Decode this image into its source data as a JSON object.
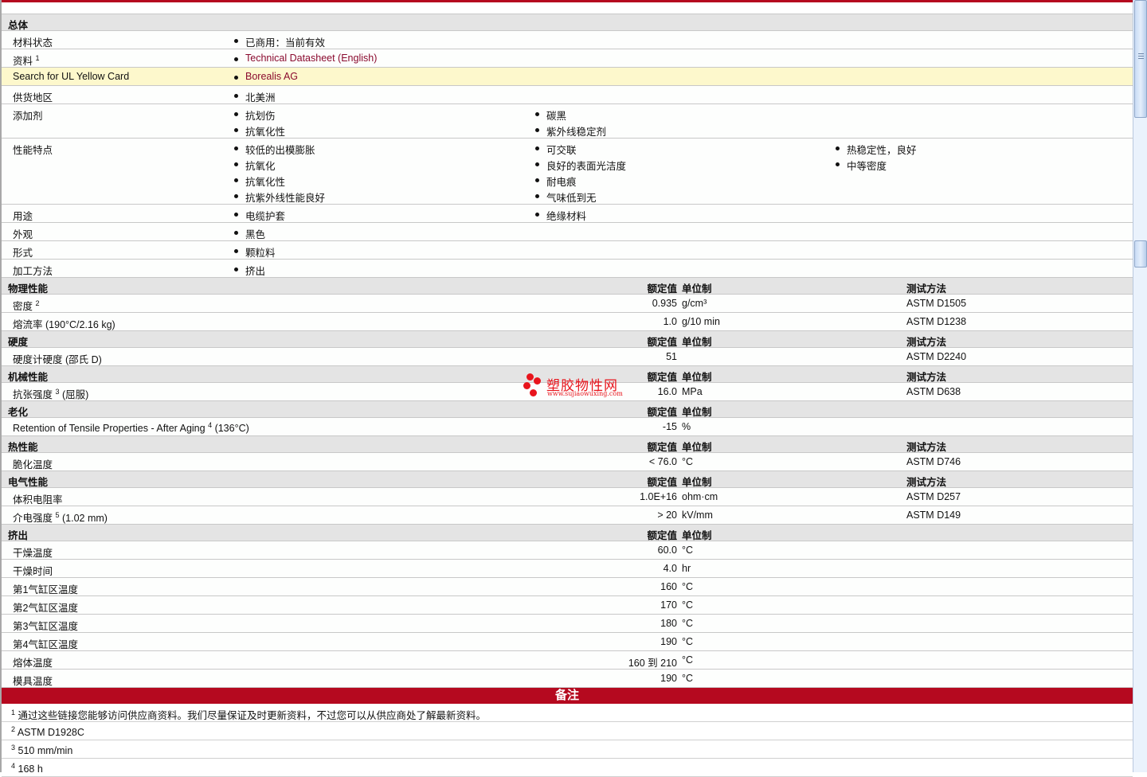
{
  "general": {
    "title": "总体",
    "rows": [
      {
        "label": "材料状态",
        "cols": [
          [
            "已商用：当前有效"
          ]
        ]
      },
      {
        "label": "资料",
        "sup": "1",
        "link": true,
        "cols": [
          [
            "Technical Datasheet (English)"
          ]
        ]
      },
      {
        "label": "Search for UL Yellow Card",
        "highlight": true,
        "link": true,
        "cols": [
          [
            "Borealis AG"
          ]
        ]
      },
      {
        "label": "供货地区",
        "cols": [
          [
            "北美洲"
          ]
        ]
      },
      {
        "label": "添加剂",
        "cols": [
          [
            "抗划伤",
            "抗氧化性"
          ],
          [
            "碳黑",
            "紫外线稳定剂"
          ]
        ]
      },
      {
        "label": "性能特点",
        "cols": [
          [
            "较低的出模膨胀",
            "抗氧化",
            "抗氧化性",
            "抗紫外线性能良好"
          ],
          [
            "可交联",
            "良好的表面光洁度",
            "耐电痕",
            "气味低到无"
          ],
          [
            "热稳定性，良好",
            "中等密度"
          ]
        ]
      },
      {
        "label": "用途",
        "cols": [
          [
            "电缆护套"
          ],
          [
            "绝缘材料"
          ]
        ]
      },
      {
        "label": "外观",
        "cols": [
          [
            "黑色"
          ]
        ]
      },
      {
        "label": "形式",
        "cols": [
          [
            "颗粒料"
          ]
        ]
      },
      {
        "label": "加工方法",
        "cols": [
          [
            "挤出"
          ]
        ]
      }
    ]
  },
  "sections": [
    {
      "title": "物理性能",
      "h_value": "额定值",
      "h_unit": "单位制",
      "h_method": "测试方法",
      "rows": [
        {
          "label": "密度",
          "sup": "2",
          "value": "0.935",
          "unit": "g/cm³",
          "method": "ASTM D1505"
        },
        {
          "label": "熔流率",
          "suffix": "(190°C/2.16 kg)",
          "value": "1.0",
          "unit": "g/10 min",
          "method": "ASTM D1238"
        }
      ]
    },
    {
      "title": "硬度",
      "h_value": "额定值",
      "h_unit": "单位制",
      "h_method": "测试方法",
      "rows": [
        {
          "label": "硬度计硬度",
          "suffix": "(邵氏 D)",
          "value": "51",
          "unit": "",
          "method": "ASTM D2240"
        }
      ]
    },
    {
      "title": "机械性能",
      "h_value": "额定值",
      "h_unit": "单位制",
      "h_method": "测试方法",
      "rows": [
        {
          "label": "抗张强度",
          "sup": "3",
          "suffix": "(屈服)",
          "value": "16.0",
          "unit": "MPa",
          "method": "ASTM D638"
        }
      ]
    },
    {
      "title": "老化",
      "h_value": "额定值",
      "h_unit": "单位制",
      "h_method": "",
      "rows": [
        {
          "label": "Retention of Tensile Properties - After Aging",
          "sup": "4",
          "suffix": "(136°C)",
          "value": "-15",
          "unit": "%",
          "method": ""
        }
      ]
    },
    {
      "title": "热性能",
      "h_value": "额定值",
      "h_unit": "单位制",
      "h_method": "测试方法",
      "rows": [
        {
          "label": "脆化温度",
          "value": "< 76.0",
          "unit": "°C",
          "method": "ASTM D746"
        }
      ]
    },
    {
      "title": "电气性能",
      "h_value": "额定值",
      "h_unit": "单位制",
      "h_method": "测试方法",
      "rows": [
        {
          "label": "体积电阻率",
          "value": "1.0E+16",
          "unit": "ohm·cm",
          "method": "ASTM D257"
        },
        {
          "label": "介电强度",
          "sup": "5",
          "suffix": "(1.02 mm)",
          "value": "> 20",
          "unit": "kV/mm",
          "method": "ASTM D149"
        }
      ]
    },
    {
      "title": "挤出",
      "h_value": "额定值",
      "h_unit": "单位制",
      "h_method": "",
      "rows": [
        {
          "label": "干燥温度",
          "value": "60.0",
          "unit": "°C",
          "method": ""
        },
        {
          "label": "干燥时间",
          "value": "4.0",
          "unit": "hr",
          "method": ""
        },
        {
          "label": "第1气缸区温度",
          "value": "160",
          "unit": "°C",
          "method": ""
        },
        {
          "label": "第2气缸区温度",
          "value": "170",
          "unit": "°C",
          "method": ""
        },
        {
          "label": "第3气缸区温度",
          "value": "180",
          "unit": "°C",
          "method": ""
        },
        {
          "label": "第4气缸区温度",
          "value": "190",
          "unit": "°C",
          "method": ""
        },
        {
          "label": "熔体温度",
          "value": "160 到  210",
          "unit": "°C",
          "method": ""
        },
        {
          "label": "模具温度",
          "value": "190",
          "unit": "°C",
          "method": ""
        }
      ]
    }
  ],
  "notes": {
    "title": "备注",
    "items": [
      {
        "num": "1",
        "text": "通过这些链接您能够访问供应商资料。我们尽量保证及时更新资料，不过您可以从供应商处了解最新资料。"
      },
      {
        "num": "2",
        "text": "ASTM D1928C"
      },
      {
        "num": "3",
        "text": "510 mm/min"
      },
      {
        "num": "4",
        "text": "168 h"
      }
    ]
  },
  "watermark": {
    "name": "塑胶物性网",
    "url": "www.sujiaowuxing.com"
  },
  "colors": {
    "accent": "#b5091f",
    "section_bg": "#e4e4e4",
    "highlight": "#fdf8cc",
    "link": "#8a0a2e"
  }
}
